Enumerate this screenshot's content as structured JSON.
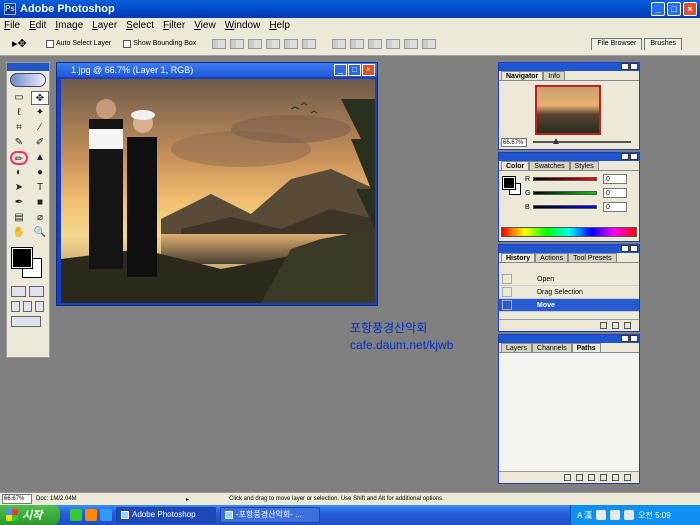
{
  "window": {
    "title": "Adobe Photoshop",
    "icon_letters": "Ps",
    "buttons": {
      "minimize": "_",
      "maximize": "□",
      "close": "×"
    }
  },
  "menu": [
    "File",
    "Edit",
    "Image",
    "Layer",
    "Select",
    "Filter",
    "View",
    "Window",
    "Help"
  ],
  "options_bar": {
    "tool_glyph": "▸✥",
    "auto_select_label": "Auto Select Layer",
    "bounding_box_label": "Show Bounding Box",
    "well_tabs": [
      "File Browser",
      "Brushes"
    ]
  },
  "toolbox": {
    "tools": [
      "▭",
      "✥",
      "ℓ",
      "✦",
      "⌗",
      "∕",
      "✎",
      "✐",
      "✏",
      "▲",
      "◐",
      "●",
      "➤",
      "T",
      "✒",
      "■",
      "▤",
      "⌀",
      "✋",
      "🔍"
    ]
  },
  "document": {
    "title": "1.jpg @ 66.7% (Layer 1, RGB)"
  },
  "watermark": {
    "line1": "포항풍경산악회",
    "line2": "cafe.daum.net/kjwb"
  },
  "navigator": {
    "tabs": [
      "Navigator",
      "Info"
    ],
    "zoom": "66.67%"
  },
  "color_palette": {
    "tabs": [
      "Color",
      "Swatches",
      "Styles"
    ],
    "channels": [
      {
        "label": "R",
        "value": "0",
        "color": "#cc0000"
      },
      {
        "label": "G",
        "value": "0",
        "color": "#00aa00"
      },
      {
        "label": "B",
        "value": "0",
        "color": "#0000cc"
      }
    ]
  },
  "history": {
    "tabs": [
      "History",
      "Actions",
      "Tool Presets"
    ],
    "items": [
      "Open",
      "Drag Selection",
      "Move"
    ]
  },
  "layers": {
    "tabs": [
      "Layers",
      "Channels",
      "Paths"
    ]
  },
  "status": {
    "zoom": "66.67%",
    "doc": "Doc: 1M/2.04M",
    "hint": "Click and drag to move layer or selection.  Use Shift and Alt for additional options."
  },
  "taskbar": {
    "start_label": "시작",
    "tasks": [
      "Adobe Photoshop",
      "-포항풍경산악회- ..."
    ],
    "tray_text": "A 漢",
    "clock": "오전 5:09"
  }
}
